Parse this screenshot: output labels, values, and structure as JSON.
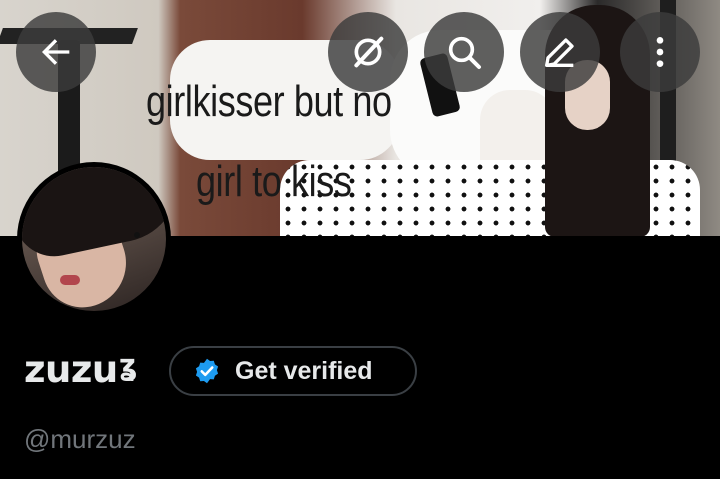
{
  "banner": {
    "meme_line_1": "girlkisser but no",
    "meme_line_2": "girl to kiss"
  },
  "header_buttons": [
    {
      "name": "back-button",
      "icon": "arrow-left-icon"
    },
    {
      "name": "grok-button",
      "icon": "grok-icon"
    },
    {
      "name": "search-button",
      "icon": "search-icon"
    },
    {
      "name": "edit-button",
      "icon": "pencil-icon"
    },
    {
      "name": "more-button",
      "icon": "more-vertical-icon"
    }
  ],
  "profile": {
    "display_name": "zuzu",
    "name_emoji": "ʓ",
    "handle": "@murzuz",
    "get_verified_label": "Get verified"
  },
  "colors": {
    "background": "#000000",
    "text": "#e7e9ea",
    "muted": "#71767b",
    "verified_blue": "#1d9bf0",
    "button_overlay": "#3c3c3c"
  }
}
